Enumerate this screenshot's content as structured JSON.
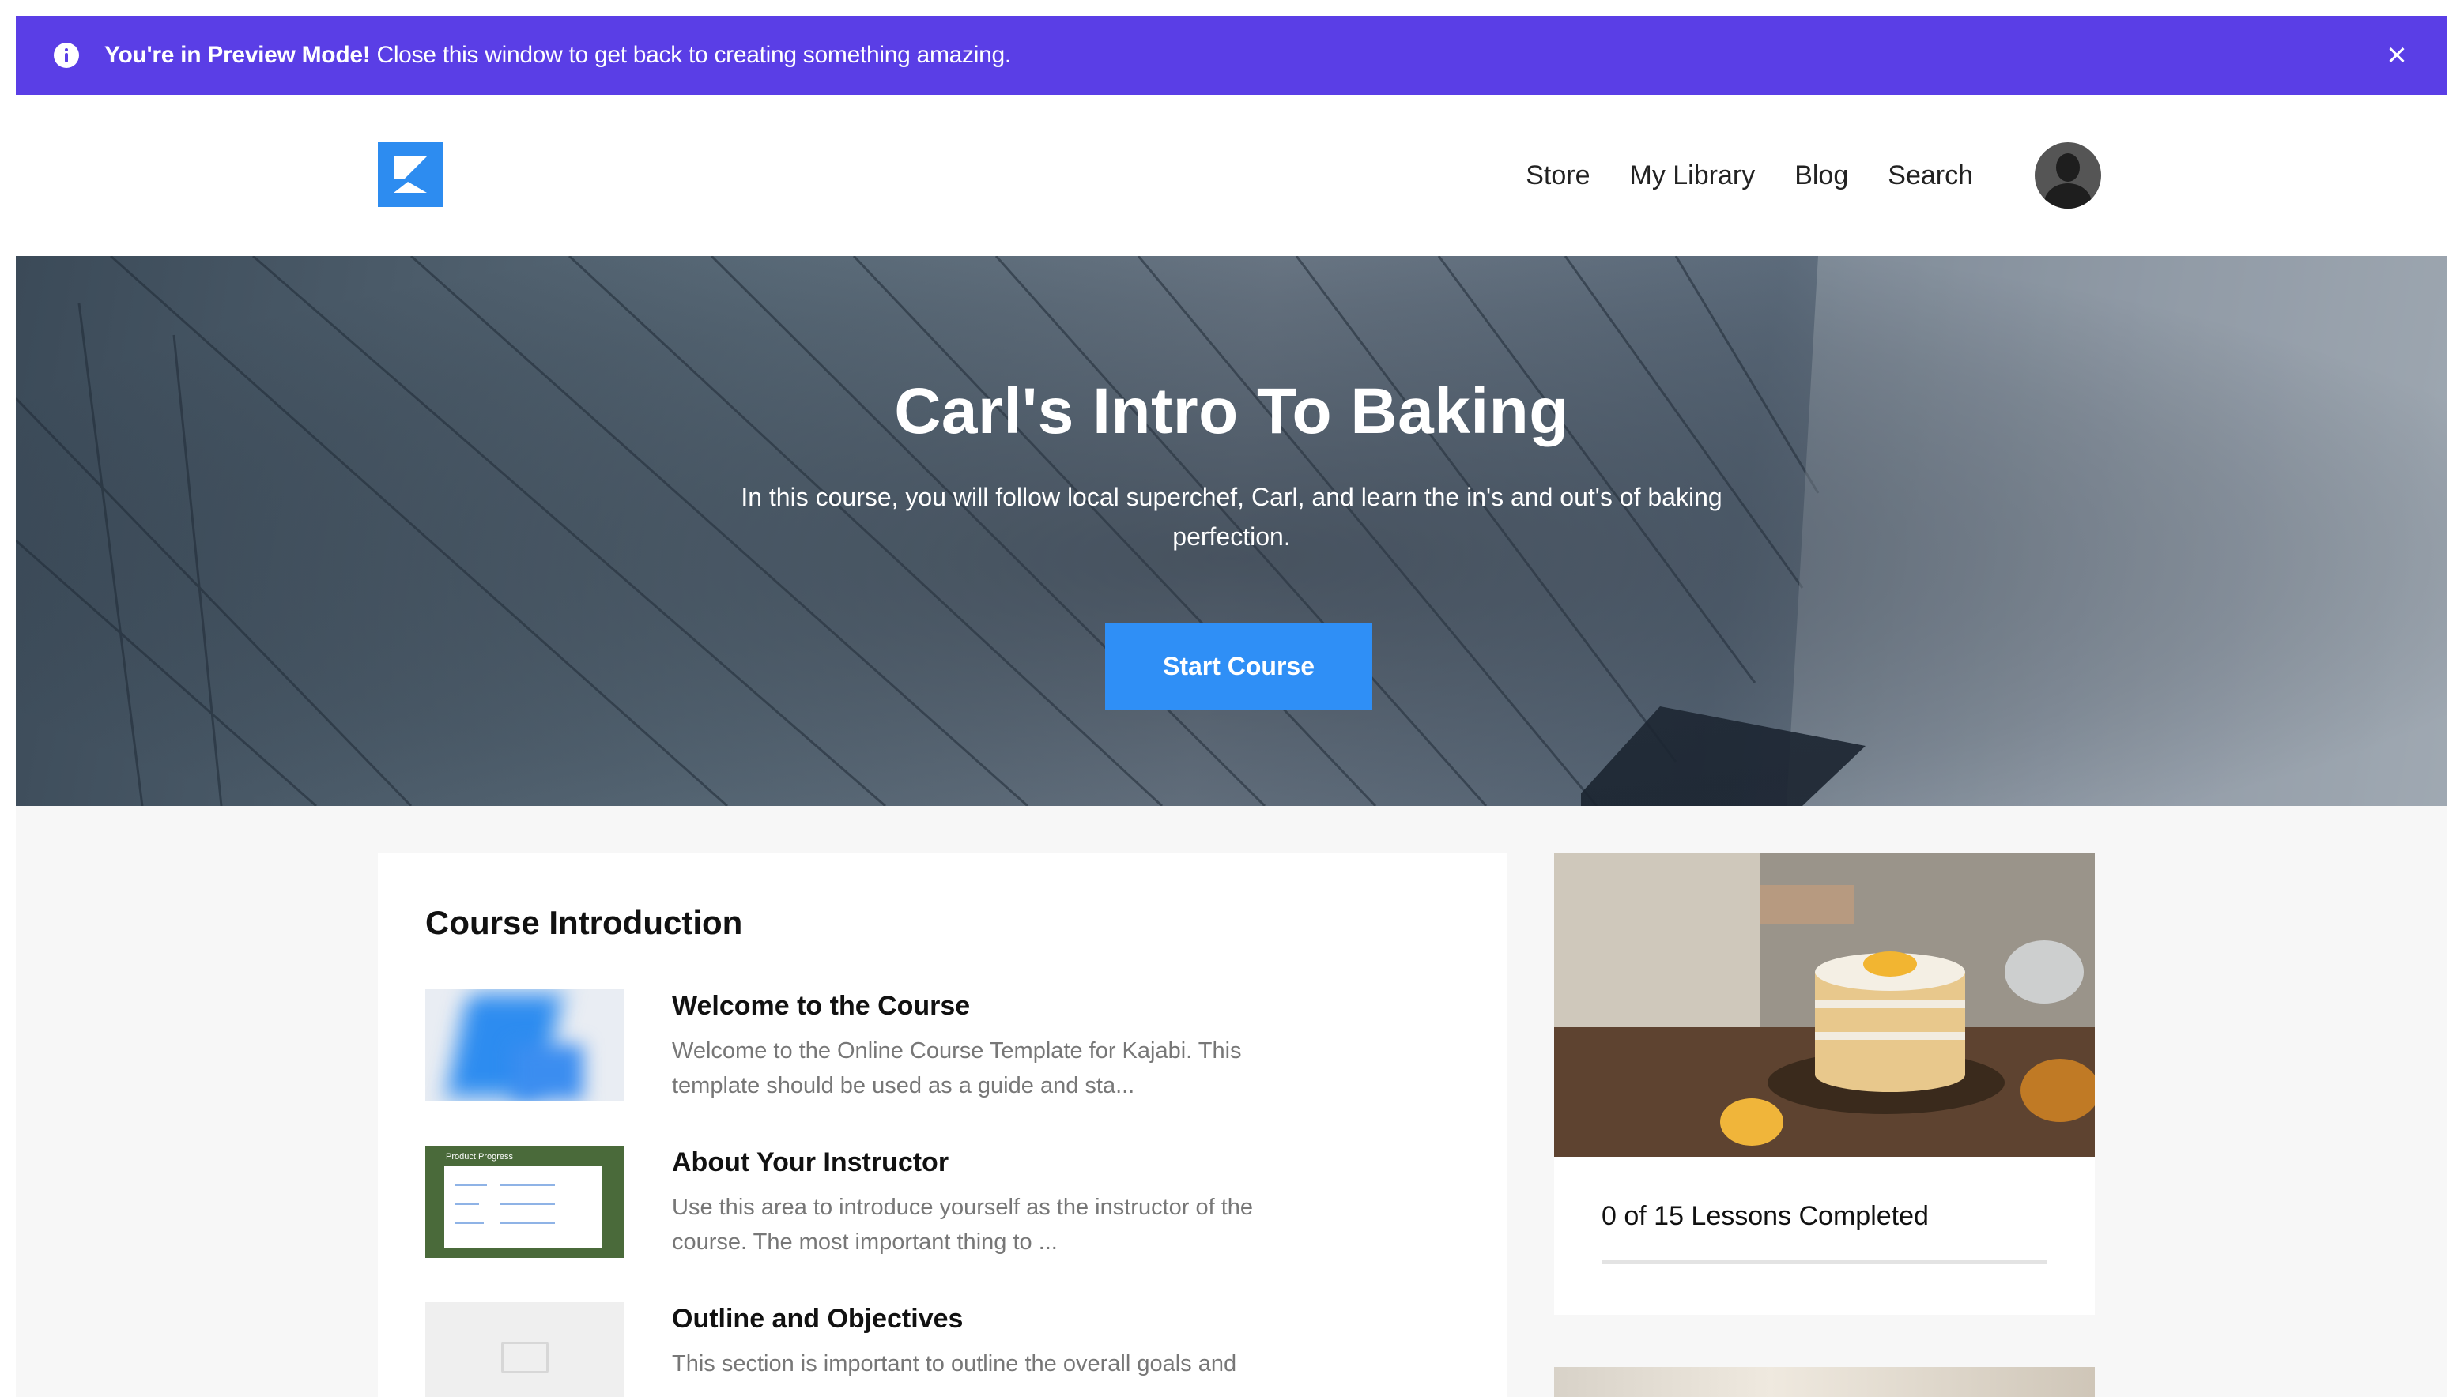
{
  "banner": {
    "bold": "You're in Preview Mode!",
    "text": " Close this window to get back to creating something amazing.",
    "info_icon": "info-icon",
    "close_icon": "close-icon"
  },
  "header": {
    "nav": [
      "Store",
      "My Library",
      "Blog",
      "Search"
    ]
  },
  "hero": {
    "title": "Carl's Intro To Baking",
    "subtitle": "In this course, you will follow local superchef, Carl, and learn the in's and out's of baking perfection.",
    "button": "Start Course"
  },
  "course": {
    "heading": "Course Introduction",
    "lessons": [
      {
        "title": "Welcome to the Course",
        "desc": "Welcome to the Online Course Template for Kajabi. This template should be used as a guide and sta..."
      },
      {
        "title": "About Your Instructor",
        "desc": "Use this area to introduce yourself as the instructor of the course. The most important thing to ..."
      },
      {
        "title": "Outline and Objectives",
        "desc": "This section is important to outline the overall goals and"
      }
    ],
    "thumb_label": "Product Progress"
  },
  "progress": {
    "label": "0 of 15 Lessons Completed",
    "completed": 0,
    "total": 15
  },
  "colors": {
    "banner": "#5a3ee6",
    "accent": "#2f8ff6"
  }
}
